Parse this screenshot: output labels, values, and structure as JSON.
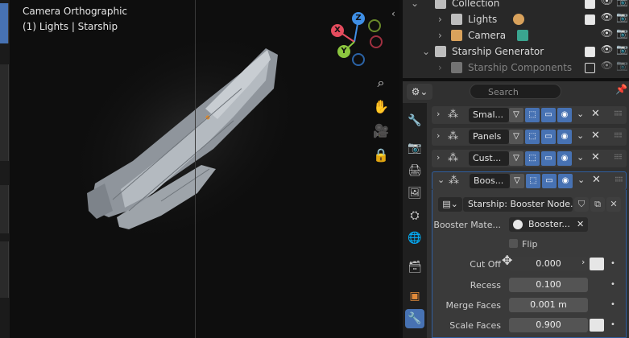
{
  "viewport": {
    "title": "Camera Orthographic",
    "subtitle": "(1) Lights | Starship",
    "gizmo": {
      "z": "Z",
      "y": "Y",
      "x": "X"
    },
    "tools": [
      "zoom-icon",
      "hand-icon",
      "camera-icon",
      "lock-icon"
    ]
  },
  "outliner": {
    "rows": [
      {
        "label": "Collection"
      },
      {
        "label": "Lights"
      },
      {
        "label": "Camera"
      },
      {
        "label": "Starship Generator"
      },
      {
        "label": "Starship Components"
      }
    ]
  },
  "properties": {
    "search_placeholder": "Search",
    "modifiers": [
      {
        "name": "Smal..."
      },
      {
        "name": "Panels"
      },
      {
        "name": "Cust..."
      },
      {
        "name": "Boos..."
      }
    ],
    "node_group": "Starship: Booster Node...",
    "fields": {
      "booster_material_label": "Booster Mate...",
      "booster_material_value": "Booster...",
      "flip_label": "Flip",
      "cutoff_label": "Cut Off",
      "cutoff_value": "0.000",
      "recess_label": "Recess",
      "recess_value": "0.100",
      "merge_label": "Merge Faces",
      "merge_value": "0.001 m",
      "scale_label": "Scale Faces",
      "scale_value": "0.900"
    }
  },
  "colors": {
    "accent_blue": "#4772b3",
    "gizmo_x": "#e64c5e",
    "gizmo_y": "#8cc73f",
    "gizmo_z": "#3f8fe6"
  }
}
